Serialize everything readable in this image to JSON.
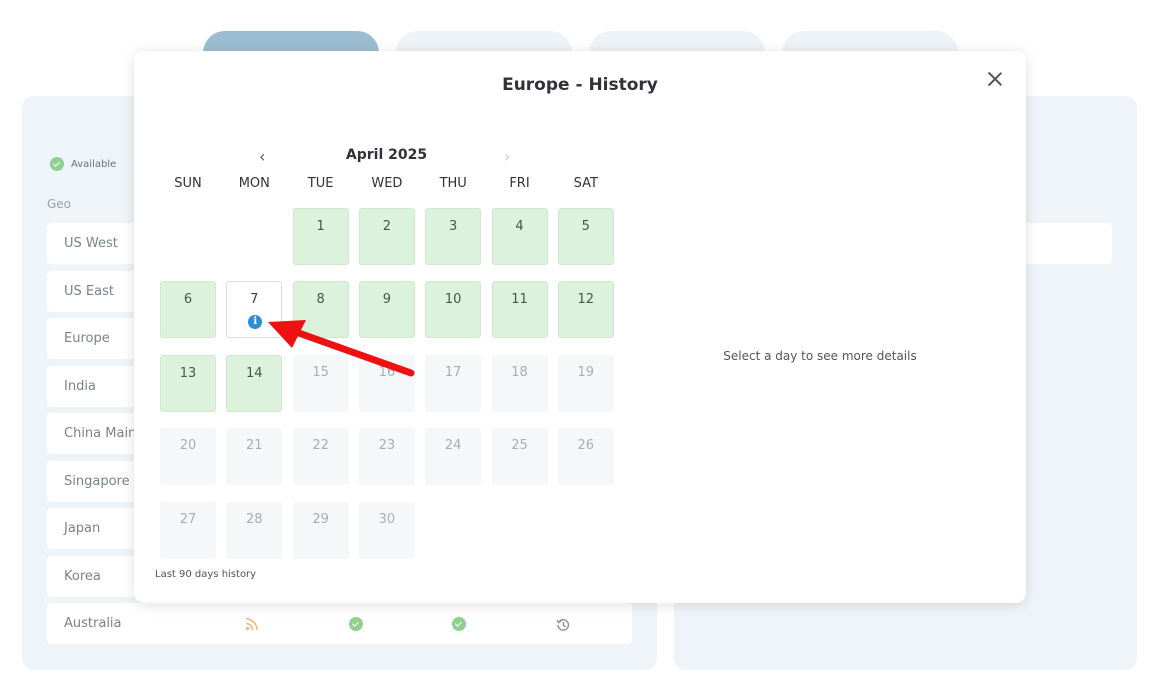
{
  "background": {
    "status_legend": {
      "label": "Available"
    },
    "geo_header": "Geo",
    "geo_rows": [
      "US West",
      "US East",
      "Europe",
      "India",
      "China Main",
      "Singapore",
      "Japan",
      "Korea",
      "Australia"
    ]
  },
  "modal": {
    "title": "Europe - History",
    "close_icon": "close-icon",
    "calendar": {
      "month_label": "April 2025",
      "prev_icon": "chevron-left-icon",
      "next_icon": "chevron-right-icon",
      "weekdays": [
        "SUN",
        "MON",
        "TUE",
        "WED",
        "THU",
        "FRI",
        "SAT"
      ],
      "days": [
        {
          "day": "1",
          "status": "ok"
        },
        {
          "day": "2",
          "status": "ok"
        },
        {
          "day": "3",
          "status": "ok"
        },
        {
          "day": "4",
          "status": "ok"
        },
        {
          "day": "5",
          "status": "ok"
        },
        {
          "day": "6",
          "status": "ok"
        },
        {
          "day": "7",
          "status": "info"
        },
        {
          "day": "8",
          "status": "ok"
        },
        {
          "day": "9",
          "status": "ok"
        },
        {
          "day": "10",
          "status": "ok"
        },
        {
          "day": "11",
          "status": "ok"
        },
        {
          "day": "12",
          "status": "ok"
        },
        {
          "day": "13",
          "status": "ok"
        },
        {
          "day": "14",
          "status": "ok"
        },
        {
          "day": "15",
          "status": "future"
        },
        {
          "day": "16",
          "status": "future"
        },
        {
          "day": "17",
          "status": "future"
        },
        {
          "day": "18",
          "status": "future"
        },
        {
          "day": "19",
          "status": "future"
        },
        {
          "day": "20",
          "status": "future"
        },
        {
          "day": "21",
          "status": "future"
        },
        {
          "day": "22",
          "status": "future"
        },
        {
          "day": "23",
          "status": "future"
        },
        {
          "day": "24",
          "status": "future"
        },
        {
          "day": "25",
          "status": "future"
        },
        {
          "day": "26",
          "status": "future"
        },
        {
          "day": "27",
          "status": "future"
        },
        {
          "day": "28",
          "status": "future"
        },
        {
          "day": "29",
          "status": "future"
        },
        {
          "day": "30",
          "status": "future"
        }
      ],
      "first_weekday_index": 2
    },
    "history_note": "Last 90 days history",
    "details_placeholder": "Select a day to see more details"
  },
  "colors": {
    "ok_day": "#ddf2dd",
    "future_day": "#f6f7f8",
    "info_icon": "#2f8ed3",
    "annotation_arrow": "#ee1111"
  }
}
